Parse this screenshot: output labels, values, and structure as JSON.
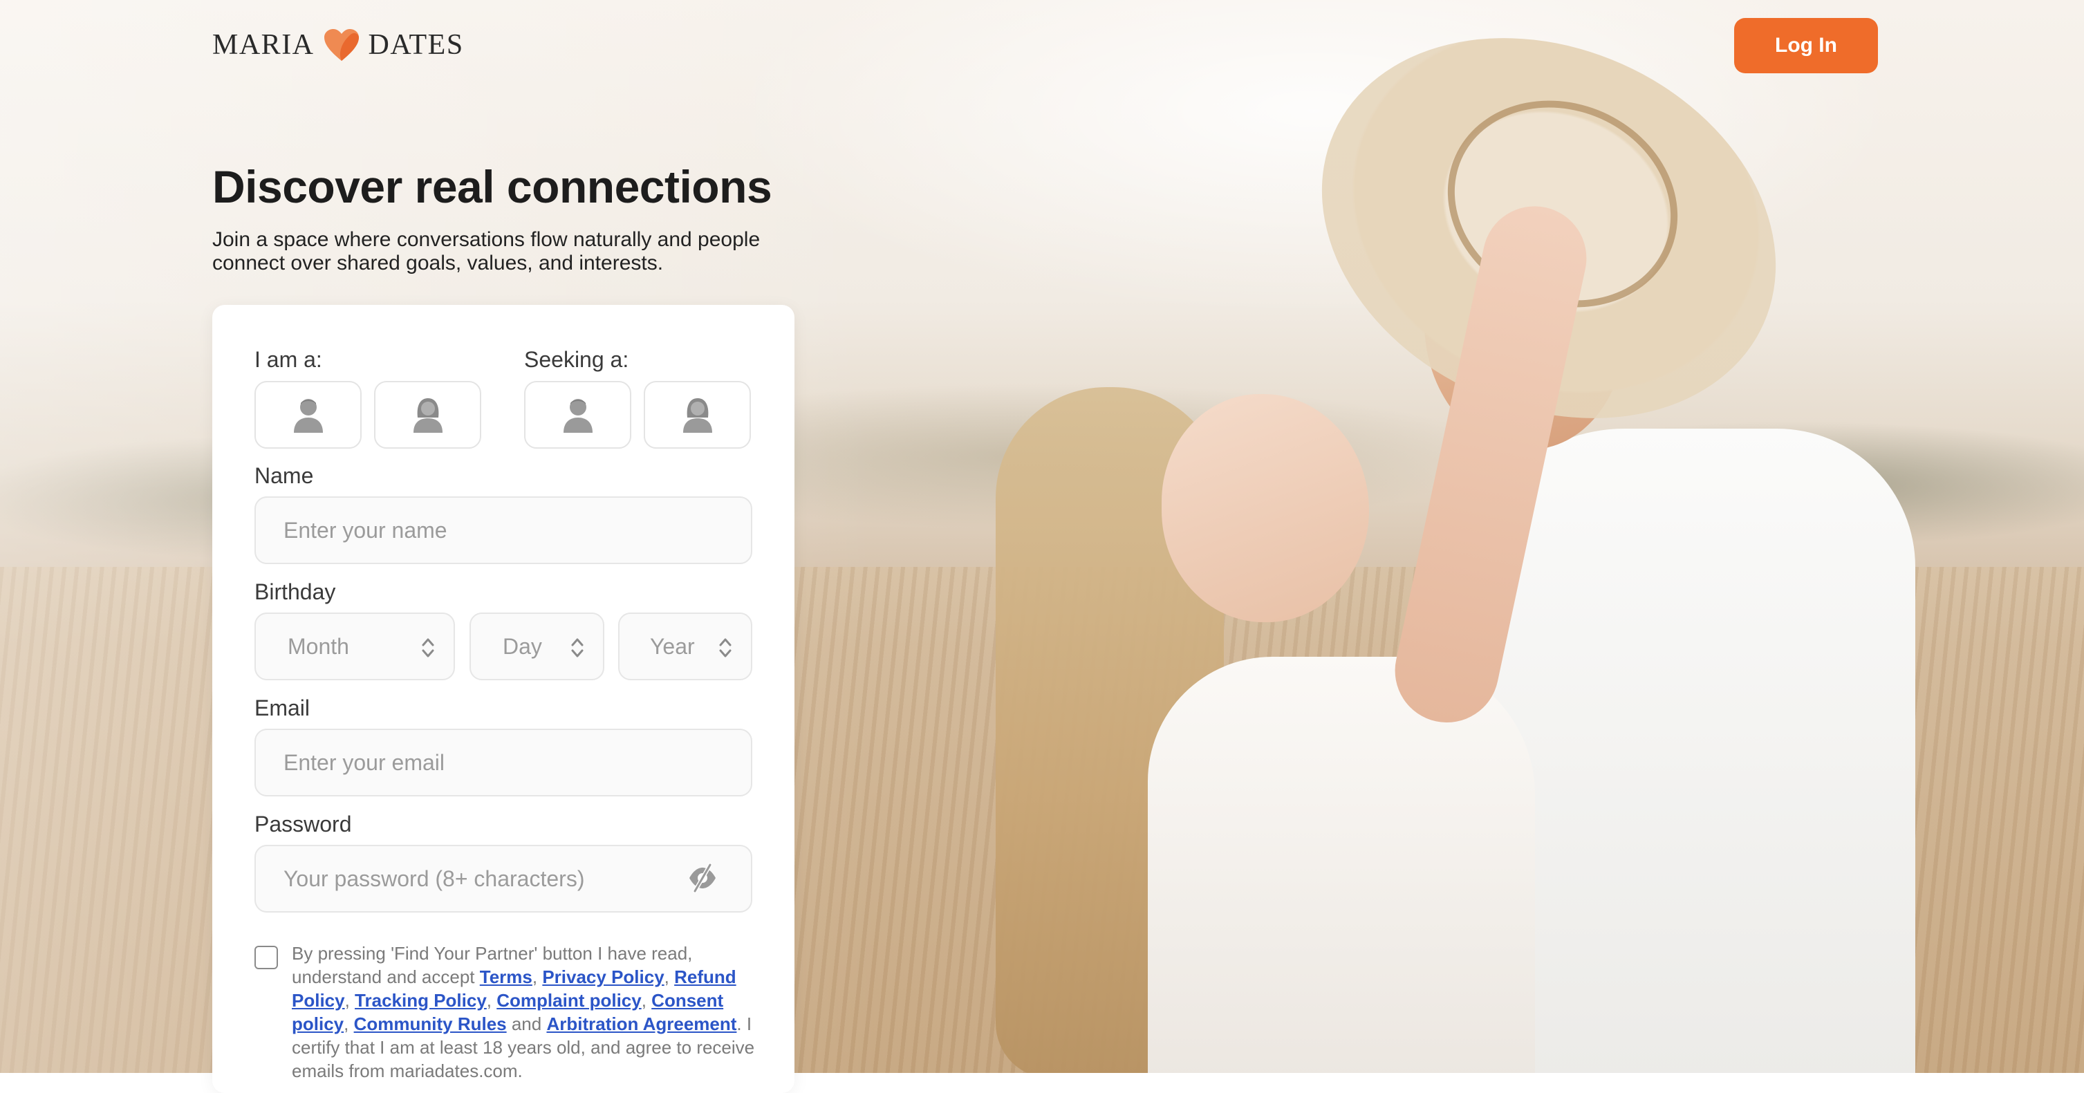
{
  "header": {
    "logo_left": "MARIA",
    "logo_right": "DATES",
    "login_label": "Log In"
  },
  "hero": {
    "title": "Discover real connections",
    "subtitle": "Join a space where conversations flow naturally and people connect over shared goals, values, and interests."
  },
  "form": {
    "i_am_label": "I am a:",
    "seeking_label": "Seeking a:",
    "name": {
      "label": "Name",
      "placeholder": "Enter your name",
      "value": ""
    },
    "birthday": {
      "label": "Birthday",
      "month_placeholder": "Month",
      "day_placeholder": "Day",
      "year_placeholder": "Year"
    },
    "email": {
      "label": "Email",
      "placeholder": "Enter your email",
      "value": ""
    },
    "password": {
      "label": "Password",
      "placeholder": "Your password (8+ characters)",
      "value": ""
    },
    "consent": {
      "checked": false,
      "text_1": "By pressing 'Find Your Partner' button I have read, understand and accept ",
      "links": [
        "Terms",
        "Privacy Policy",
        "Refund Policy",
        "Tracking Policy",
        "Complaint policy",
        "Consent policy",
        "Community Rules",
        "Arbitration Agreement"
      ],
      "sep_comma": ", ",
      "sep_and": " and ",
      "text_2": ". I certify that I am at least 18 years old, and agree to receive emails from mariadates.com."
    }
  },
  "colors": {
    "accent": "#ef6c2a",
    "link": "#2b55c7"
  },
  "icons": {
    "logo": "heart-logo-icon",
    "male": "male-avatar-icon",
    "female": "female-avatar-icon",
    "chevron": "chevron-updown-icon",
    "eye": "eye-slash-icon"
  }
}
